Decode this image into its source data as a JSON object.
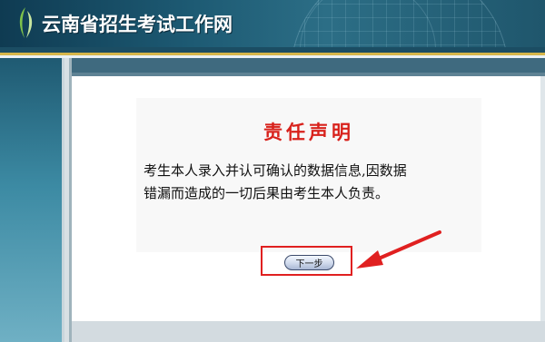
{
  "header": {
    "site_title": "云南省招生考试工作网",
    "logo_icon": "leaf-logo-icon"
  },
  "disclaimer": {
    "title": "责任声明",
    "text_line_1": "考生本人录入并认可确认的数据信息,因数据",
    "text_line_2": "错漏而造成的一切后果由考生本人负责。"
  },
  "actions": {
    "next_label": "下一步"
  },
  "annotation": {
    "highlight_color": "#e02020",
    "arrow_color": "#e02020"
  },
  "colors": {
    "header_bg": "#1d5a73",
    "accent_gold": "#d6b64a",
    "title_red": "#d8211b"
  }
}
